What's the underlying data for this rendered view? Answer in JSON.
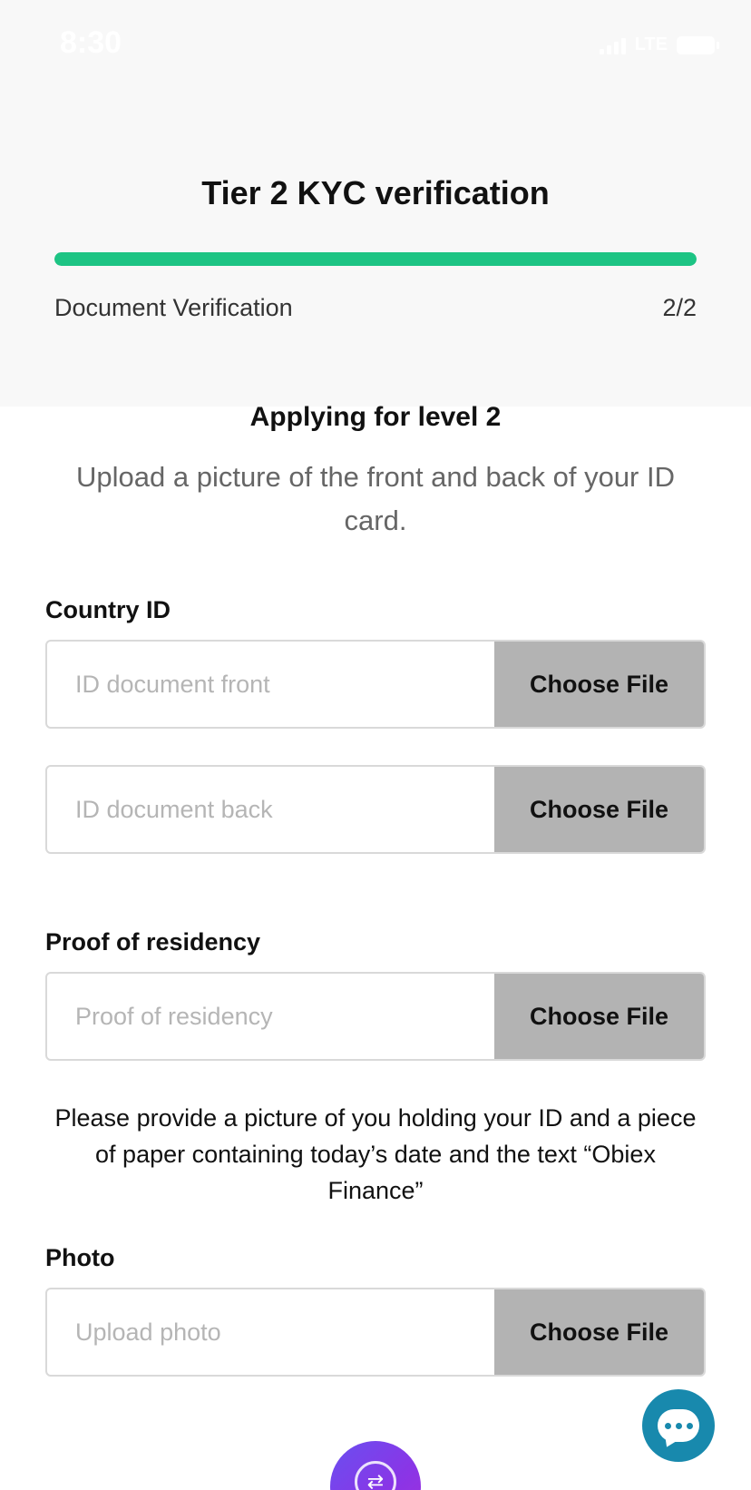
{
  "status_bar": {
    "time": "8:30",
    "network": "LTE"
  },
  "header": {
    "title": "Tier 2 KYC verification",
    "progress": 1.0,
    "step_label": "Document Verification",
    "step_count": "2/2"
  },
  "main": {
    "level_title": "Applying for level 2",
    "instruction": "Upload a picture of the front and back of your ID card.",
    "country_id": {
      "label": "Country ID",
      "front": {
        "placeholder": "ID document front",
        "button": "Choose File"
      },
      "back": {
        "placeholder": "ID document back",
        "button": "Choose File"
      }
    },
    "residency": {
      "label": "Proof of residency",
      "field": {
        "placeholder": "Proof of residency",
        "button": "Choose File"
      }
    },
    "note": "Please provide a picture of you holding your ID and a piece of paper containing today’s date and the text “Obiex Finance”",
    "photo": {
      "label": "Photo",
      "field": {
        "placeholder": "Upload photo",
        "button": "Choose File"
      }
    }
  },
  "icons": {
    "chat": "chat-bubble-icon",
    "swap": "swap-icon"
  },
  "colors": {
    "accent": "#1dc484",
    "chat": "#1889ad",
    "button_gray": "#b3b3b3",
    "swap_gradient_start": "#6a4ff0",
    "swap_gradient_end": "#a02fdc"
  }
}
